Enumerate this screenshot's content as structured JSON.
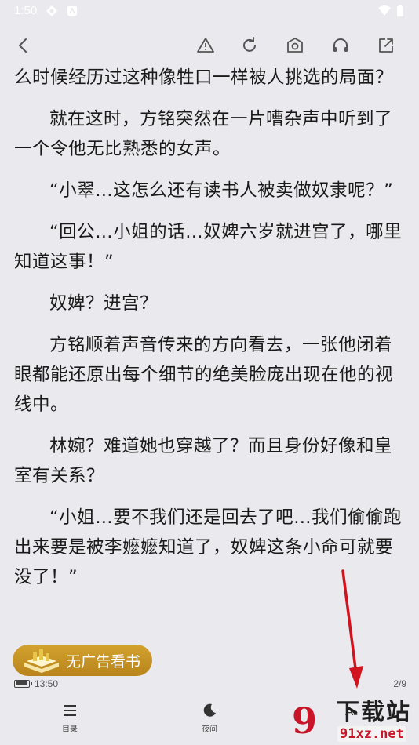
{
  "status_bar": {
    "time": "1:50"
  },
  "toolbar": {
    "back_icon": "chevron-left-icon",
    "report_icon": "warning-triangle-icon",
    "refresh_icon": "refresh-icon",
    "camera_icon": "camera-icon",
    "listen_icon": "headphones-icon",
    "share_icon": "external-link-icon"
  },
  "reader": {
    "paragraphs": [
      "么时候经历过这种像牲口一样被人挑选的局面？",
      "就在这时，方铭突然在一片嘈杂声中听到了一个令他无比熟悉的女声。",
      "“小翠…这怎么还有读书人被卖做奴隶呢？”",
      "“回公…小姐的话…奴婢六岁就进宫了，哪里知道这事！”",
      "奴婢？进宫？",
      "方铭顺着声音传来的方向看去，一张他闭着眼都能还原出每个细节的绝美脸庞出现在他的视线中。",
      "林婉？难道她也穿越了？而且身份好像和皇室有关系？",
      "“小姐…要不我们还是回去了吧…我们偷偷跑出来要是被李嬷嬷知道了，奴婢这条小命可就要没了！”"
    ]
  },
  "ad": {
    "label": "无广告看书"
  },
  "footer": {
    "clock": "13:50",
    "page": "2/9",
    "battery_level": 0.9
  },
  "bottom_nav": {
    "toc_label": "目录",
    "night_label": "夜间"
  },
  "watermark": {
    "brand": "下载站",
    "url": "91xz.net",
    "logo_text": "9"
  },
  "colors": {
    "background": "#e9e9ee",
    "ad_gold": "#c8951f",
    "annotation_red": "#d0131f"
  }
}
